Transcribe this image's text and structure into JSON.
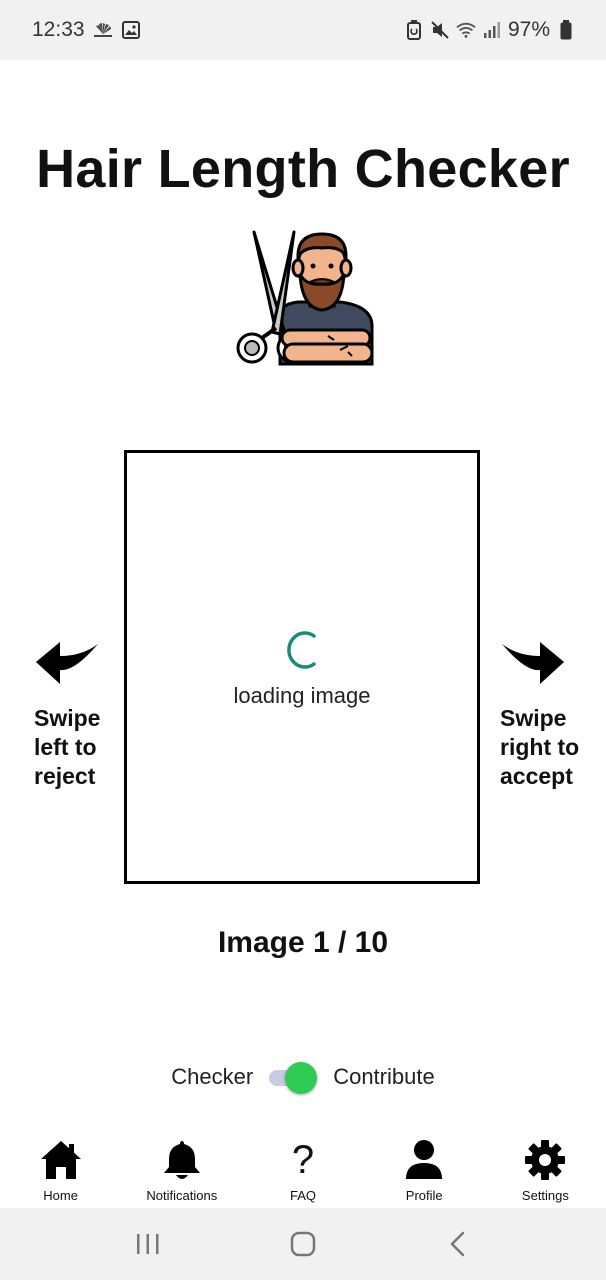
{
  "status_bar": {
    "time": "12:33",
    "battery": "97%",
    "icons": [
      "cnbc-icon",
      "image-icon",
      "battery-saver-icon",
      "mute-icon",
      "wifi-icon",
      "signal-icon",
      "battery-icon"
    ]
  },
  "app": {
    "title": "Hair Length Checker",
    "illustration": "barber-with-scissors-icon"
  },
  "image_viewer": {
    "loading_text": "loading image",
    "counter": "Image 1 / 10"
  },
  "swipe": {
    "left": {
      "line1": "Swipe",
      "line2": "left to",
      "line3": "reject"
    },
    "right": {
      "line1": "Swipe",
      "line2": "right to",
      "line3": "accept"
    }
  },
  "mode_toggle": {
    "left_label": "Checker",
    "right_label": "Contribute",
    "selected": "Contribute",
    "accent": "#2ecc52",
    "track_color": "#c7cbe6"
  },
  "bottom_nav": {
    "items": [
      {
        "label": "Home",
        "icon": "home-icon"
      },
      {
        "label": "Notifications",
        "icon": "bell-icon"
      },
      {
        "label": "FAQ",
        "icon": "question-icon",
        "glyph": "?"
      },
      {
        "label": "Profile",
        "icon": "person-icon"
      },
      {
        "label": "Settings",
        "icon": "gear-icon"
      }
    ]
  },
  "system_nav": [
    "recents-icon",
    "home-circle-icon",
    "back-icon"
  ],
  "colors": {
    "spinner": "#1a8a7a",
    "status_bar_bg": "#f1f1f1"
  }
}
